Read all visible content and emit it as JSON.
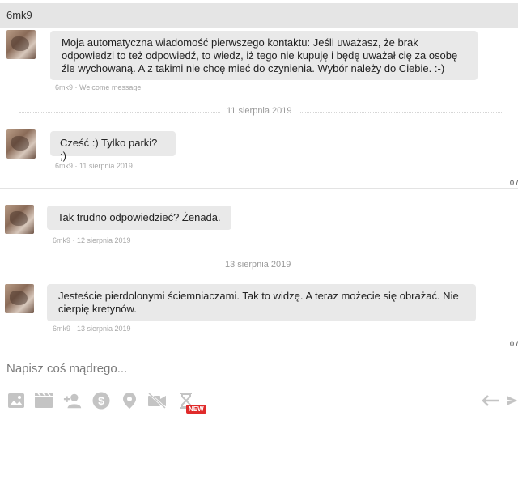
{
  "header": {
    "title": "6mk9"
  },
  "messages": [
    {
      "text": "Moja automatyczna wiadomość pierwszego kontaktu: Jeśli uważasz, że brak odpowiedzi to też odpowiedź, to wiedz, iż tego nie kupuję i będę uważał cię za osobę źle wychowaną. A z takimi nie chcę mieć do czynienia. Wybór należy do Ciebie. :-)",
      "meta": "6mk9 · Welcome message"
    },
    {
      "text": "Cześć :) Tylko parki? ;)",
      "meta": "6mk9 · 11 sierpnia 2019"
    },
    {
      "text": "Tak trudno odpowiedzieć? Żenada.",
      "meta": "6mk9 · 12 sierpnia 2019"
    },
    {
      "text": "Jesteście pierdolonymi ściemniaczami. Tak to widzę. A teraz możecie się obrażać. Nie cierpię kretynów.",
      "meta": "6mk9 · 13 sierpnia 2019"
    }
  ],
  "dates": {
    "d1": "11 sierpnia 2019",
    "d2": "13 sierpnia 2019"
  },
  "counters": {
    "c1": "0 /",
    "c2": "0 /"
  },
  "composer": {
    "placeholder": "Napisz coś mądrego..."
  },
  "toolbar": {
    "icons": [
      "image-icon",
      "video-icon",
      "add-user-icon",
      "dollar-icon",
      "location-icon",
      "video-off-icon",
      "hourglass-icon",
      "undo-icon",
      "send-icon"
    ],
    "badge": "NEW"
  },
  "colors": {
    "bubble": "#e9e9e9",
    "header": "#e5e5e5",
    "icon": "#c4c4c4",
    "badge": "#e02b2b"
  }
}
